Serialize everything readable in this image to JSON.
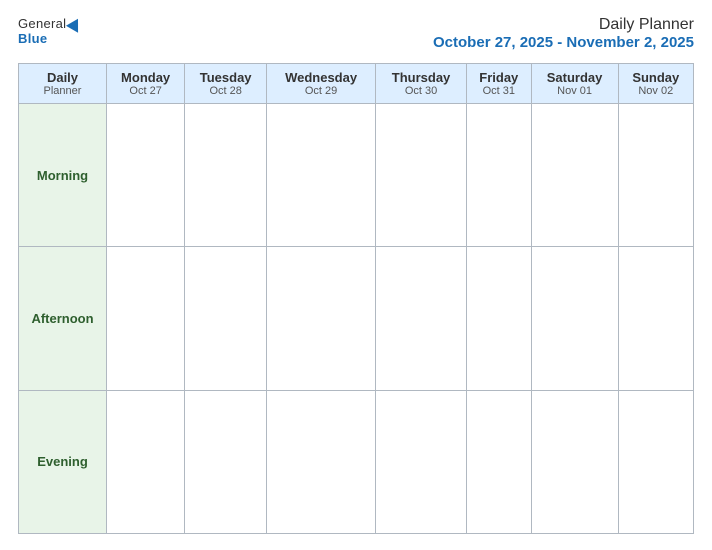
{
  "logo": {
    "general": "General",
    "blue": "Blue"
  },
  "header": {
    "title": "Daily Planner",
    "date_range": "October 27, 2025 - November 2, 2025"
  },
  "table": {
    "label_header": {
      "line1": "Daily",
      "line2": "Planner"
    },
    "days": [
      {
        "name": "Monday",
        "sub": "Oct 27"
      },
      {
        "name": "Tuesday",
        "sub": "Oct 28"
      },
      {
        "name": "Wednesday",
        "sub": "Oct 29"
      },
      {
        "name": "Thursday",
        "sub": "Oct 30"
      },
      {
        "name": "Friday",
        "sub": "Oct 31"
      },
      {
        "name": "Saturday",
        "sub": "Nov 01"
      },
      {
        "name": "Sunday",
        "sub": "Nov 02"
      }
    ],
    "rows": [
      {
        "label": "Morning"
      },
      {
        "label": "Afternoon"
      },
      {
        "label": "Evening"
      }
    ]
  }
}
